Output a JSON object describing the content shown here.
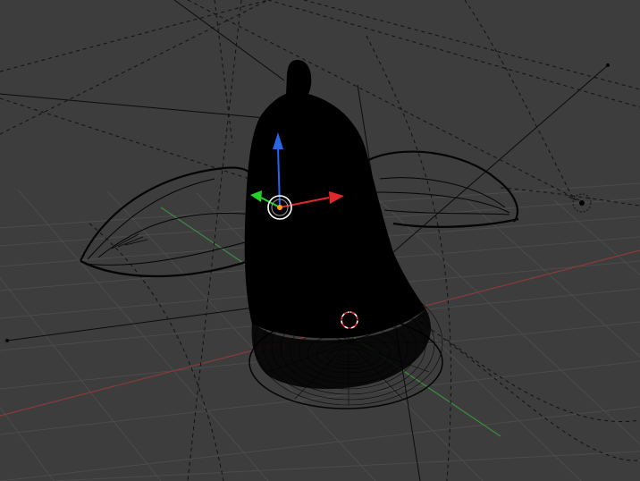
{
  "viewport": {
    "name": "3D Viewport",
    "background": "#3d3d3d",
    "grid_color": "#4a4a4a",
    "x_axis_color": "#8a3a3a",
    "y_axis_color": "#3f8a3f"
  },
  "scene": {
    "objects": [
      "bell-mesh",
      "left-wing",
      "right-wing",
      "wireframe-base",
      "guide-curves"
    ],
    "active_object": "bell-mesh"
  },
  "gizmo": {
    "type": "translate",
    "axis_colors": {
      "x": "#e02828",
      "y": "#28d028",
      "z": "#2866e8"
    },
    "pivot_color": "#ff9a1a"
  },
  "cursor_3d": {
    "colors": [
      "#ff2a2a",
      "#ffffff"
    ]
  }
}
